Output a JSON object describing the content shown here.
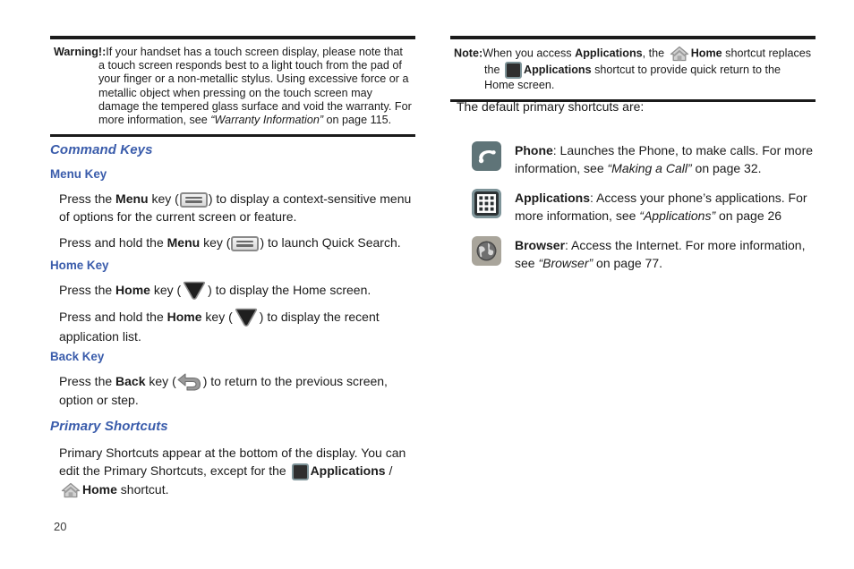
{
  "page": {
    "number": "20"
  },
  "left_column": {
    "warning": {
      "label": "Warning!:",
      "text_part1": "If your handset has a touch screen display, please note that a touch screen responds best to a light touch from the pad of your finger or a non-metallic stylus. Using excessive force or a metallic object when pressing on the touch screen may damage the tempered glass surface and void the warranty. For more information, see ",
      "reference": "“Warranty Information”",
      "text_part2": " on page 115."
    },
    "section_heading": "Command Keys",
    "menu_key": {
      "heading": "Menu Key",
      "p1_a": "Press the ",
      "p1_bold": "Menu",
      "p1_b": " key (",
      "p1_c": ") to display a context-sensitive menu of options for the current screen or feature.",
      "p2_a": "Press and hold the ",
      "p2_bold": "Menu",
      "p2_b": " key (",
      "p2_c": ") to launch Quick Search."
    },
    "home_key": {
      "heading": "Home Key",
      "p1_a": "Press the ",
      "p1_bold": "Home",
      "p1_b": " key (",
      "p1_c": ") to display the Home screen.",
      "p2_a": "Press and hold the ",
      "p2_bold": "Home",
      "p2_b": " key (",
      "p2_c": ") to display the recent application list."
    },
    "back_key": {
      "heading": "Back Key",
      "p1_a": "Press the ",
      "p1_bold": "Back",
      "p1_b": " key (",
      "p1_c": ") to return to the previous screen, option or step."
    },
    "primary_shortcuts": {
      "heading": "Primary Shortcuts",
      "p_a": "Primary Shortcuts appear at the bottom of the display. You can edit the Primary Shortcuts, except for the ",
      "p_apps_label": "Applications",
      "p_slash": " / ",
      "p_home_label": "Home",
      "p_end": " shortcut."
    }
  },
  "right_column": {
    "note": {
      "label": "Note:",
      "t1": "When you access ",
      "t_apps_bold": "Applications",
      "t2": ", the ",
      "t_home_bold": "Home",
      "t3": " shortcut replaces the ",
      "t_apps_bold2": "Applications",
      "t4": " shortcut to provide quick return to the Home screen."
    },
    "intro": "The default primary shortcuts are:",
    "shortcuts": [
      {
        "icon": "phone-icon",
        "name": "Phone",
        "desc_a": ": Launches the Phone, to make calls. For more information, see ",
        "reference": "“Making a Call”",
        "desc_b": " on page 32."
      },
      {
        "icon": "applications-grid-icon",
        "name": "Applications",
        "desc_a": ": Access your phone’s applications. For more information, see ",
        "reference": "“Applications”",
        "desc_b": " on page 26"
      },
      {
        "icon": "browser-globe-icon",
        "name": "Browser",
        "desc_a": ": Access the Internet. For more information, see ",
        "reference": "“Browser”",
        "desc_b": " on page 77."
      }
    ]
  },
  "colors": {
    "heading_blue": "#3a5cab",
    "rule_black": "#1b1b1b",
    "tile_phone": "#5f7478",
    "tile_apps": "#2c3234",
    "tile_apps_border": "#7e9499",
    "tile_browser": "#a9a59b"
  }
}
